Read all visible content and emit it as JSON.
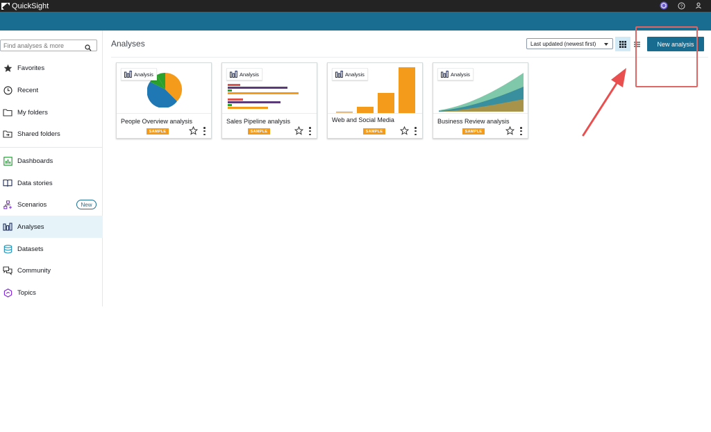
{
  "app": {
    "name": "QuickSight"
  },
  "search": {
    "placeholder": "Find analyses & more"
  },
  "sidebar": {
    "items": [
      {
        "label": "Favorites",
        "icon": "star-icon"
      },
      {
        "label": "Recent",
        "icon": "clock-icon"
      },
      {
        "label": "My folders",
        "icon": "folder-icon"
      },
      {
        "label": "Shared folders",
        "icon": "shared-folder-icon"
      },
      {
        "label": "Dashboards",
        "icon": "dashboard-icon"
      },
      {
        "label": "Data stories",
        "icon": "book-icon"
      },
      {
        "label": "Scenarios",
        "icon": "scenario-icon",
        "badge": "New"
      },
      {
        "label": "Analyses",
        "icon": "analysis-icon",
        "active": true
      },
      {
        "label": "Datasets",
        "icon": "dataset-icon"
      },
      {
        "label": "Community",
        "icon": "chat-icon"
      },
      {
        "label": "Topics",
        "icon": "topic-icon"
      }
    ]
  },
  "main": {
    "title": "Analyses",
    "sort": {
      "selected": "Last updated (newest first)"
    },
    "new_button": "New analysis",
    "cards": [
      {
        "type": "Analysis",
        "title": "People Overview analysis",
        "badge": "SAMPLE"
      },
      {
        "type": "Analysis",
        "title": "Sales Pipeline analysis",
        "badge": "SAMPLE"
      },
      {
        "type": "Analysis",
        "title": "Web and Social Media",
        "badge": "SAMPLE"
      },
      {
        "type": "Analysis",
        "title": "Business Review analysis",
        "badge": "SAMPLE"
      }
    ]
  },
  "colors": {
    "brand": "#196d91",
    "button": "#176c90",
    "sample": "#f59b1c",
    "annotation": "#e06666"
  }
}
